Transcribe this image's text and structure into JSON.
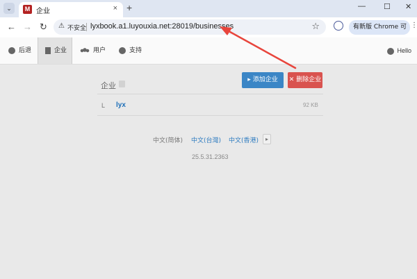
{
  "browser": {
    "tab_title": "企业",
    "favicon_letter": "M",
    "tab_menu_glyph": "⌄",
    "close_glyph": "×",
    "newtab_glyph": "+",
    "minimize_glyph": "—",
    "maximize_glyph": "☐",
    "window_close_glyph": "✕",
    "back_glyph": "←",
    "forward_glyph": "→",
    "reload_glyph": "↻",
    "insecure_label": "不安全",
    "url": "lyxbook.a1.luyouxia.net:28019/businesses",
    "star_glyph": "☆",
    "update_label": "有新版 Chrome 可用",
    "more_glyph": "⋮"
  },
  "nav": {
    "back": "后退",
    "business": "企业",
    "users": "用户",
    "support": "支持",
    "hello": "Hello"
  },
  "page": {
    "title": "企业",
    "add_button": "添加企业",
    "delete_button": "删除企业",
    "rows": [
      {
        "letter": "L",
        "name": "lyx",
        "size": "92 KB"
      }
    ]
  },
  "footer": {
    "languages": [
      "中文(简体)",
      "中文(台灣)",
      "中文(香港)"
    ],
    "more_glyph": "▸",
    "version": "25.5.31.2363"
  },
  "colors": {
    "annotation_arrow": "#e8453c",
    "add_button": "#3b86c6",
    "delete_button": "#d9534f",
    "link": "#2d7bc0"
  }
}
